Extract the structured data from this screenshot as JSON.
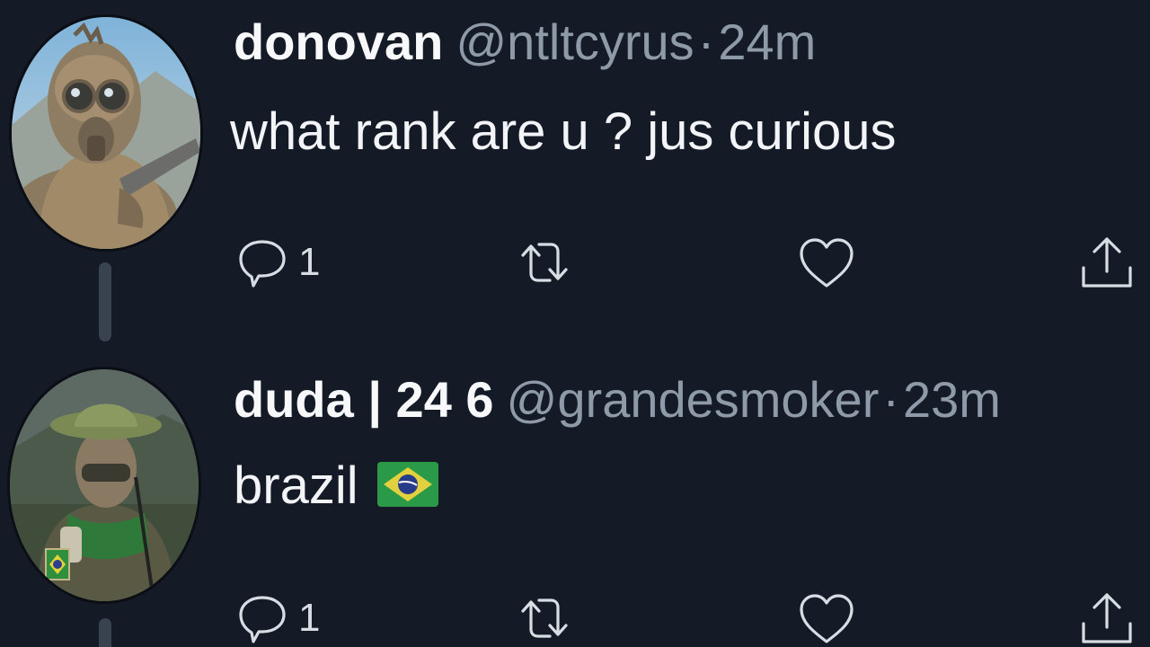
{
  "tweets": [
    {
      "display_name": "donovan",
      "handle": "@ntltcyrus",
      "time_separator": "·",
      "timestamp": "24m",
      "text": "what rank are u ? jus curious",
      "emoji": "",
      "reply_count": "1",
      "avatar_icon": "gas-mask-soldier-avatar"
    },
    {
      "display_name": "duda | 24 6",
      "handle": "@grandesmoker",
      "time_separator": "·",
      "timestamp": "23m",
      "text": "brazil",
      "emoji": "brazil-flag-emoji",
      "reply_count": "1",
      "avatar_icon": "bucket-hat-soldier-avatar"
    }
  ],
  "icons": {
    "reply": "reply-icon",
    "retweet": "retweet-icon",
    "like": "heart-icon",
    "share": "share-icon"
  },
  "colors": {
    "background": "#151b26",
    "name_text": "#f6f8fa",
    "secondary_text": "#8e9aa8",
    "icon_stroke": "#d8dde4",
    "thread_line": "#39424f"
  }
}
